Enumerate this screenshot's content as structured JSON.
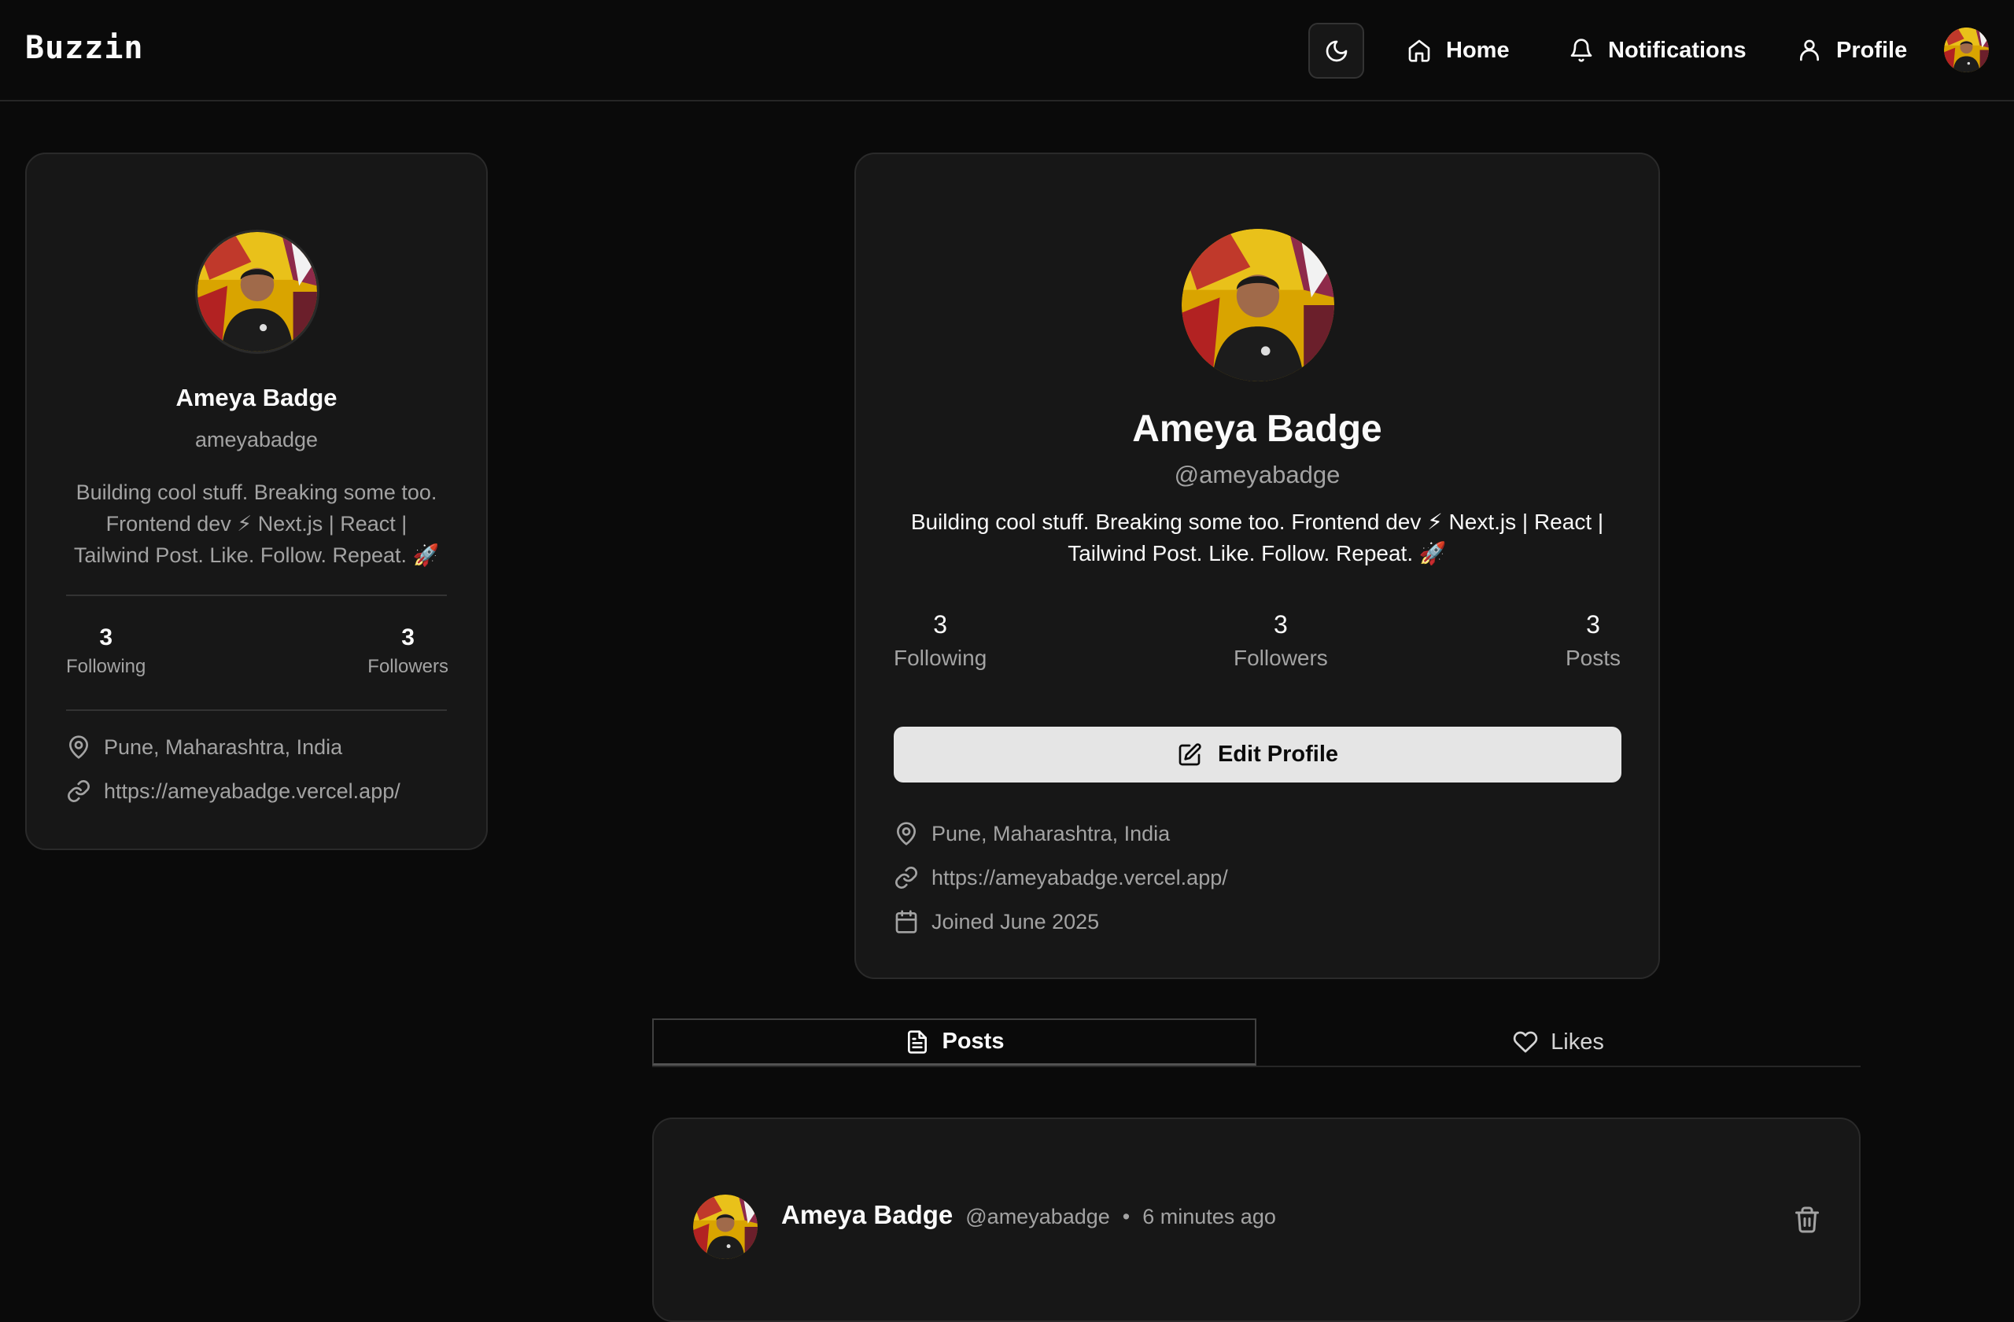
{
  "app": {
    "brand": "Buzzin"
  },
  "nav": {
    "home": "Home",
    "notifications": "Notifications",
    "profile": "Profile",
    "theme_icon": "moon-icon"
  },
  "sidebar_profile": {
    "name": "Ameya Badge",
    "username": "ameyabadge",
    "bio": "Building cool stuff. Breaking some too. Frontend dev ⚡ Next.js | React | Tailwind Post. Like. Follow. Repeat. 🚀",
    "following_count": "3",
    "following_label": "Following",
    "followers_count": "3",
    "followers_label": "Followers",
    "location": "Pune, Maharashtra, India",
    "website": "https://ameyabadge.vercel.app/"
  },
  "profile": {
    "name": "Ameya Badge",
    "handle": "@ameyabadge",
    "bio": "Building cool stuff. Breaking some too. Frontend dev ⚡ Next.js | React | Tailwind Post. Like. Follow. Repeat. 🚀",
    "following_count": "3",
    "following_label": "Following",
    "followers_count": "3",
    "followers_label": "Followers",
    "posts_count": "3",
    "posts_label": "Posts",
    "edit_button": "Edit Profile",
    "location": "Pune, Maharashtra, India",
    "website": "https://ameyabadge.vercel.app/",
    "joined": "Joined June 2025"
  },
  "tabs": [
    {
      "label": "Posts",
      "icon": "file-text-icon",
      "active": true
    },
    {
      "label": "Likes",
      "icon": "heart-icon",
      "active": false
    }
  ],
  "posts": [
    {
      "author": "Ameya Badge",
      "handle": "@ameyabadge",
      "separator": "•",
      "time": "6 minutes ago"
    }
  ],
  "colors": {
    "background": "#0a0a0a",
    "card": "#171717",
    "muted_text": "#a3a3a3",
    "button_light": "#e5e5e5"
  }
}
